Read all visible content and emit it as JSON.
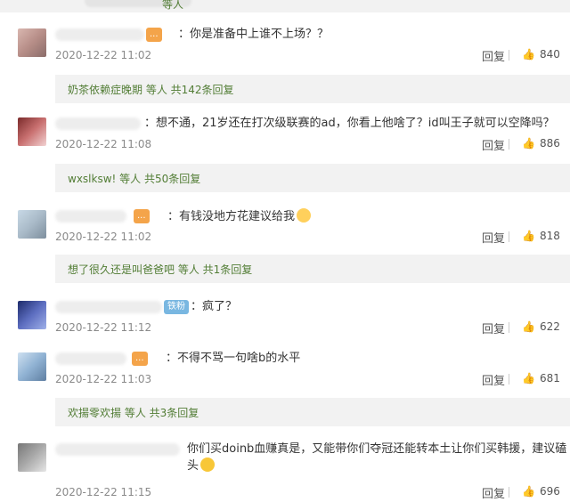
{
  "top": {
    "text": "等人"
  },
  "comments": [
    {
      "badge": "...",
      "text": "：你是准备中上谁不上场？？",
      "time": "2020-12-22 11:02",
      "reply_label": "回复",
      "likes": "840",
      "reply_summary": "奶茶依赖症晚期 等人 共142条回复"
    },
    {
      "badge": "",
      "text": "：想不通，21岁还在打次级联赛的ad，你看上他啥了？id叫王子就可以空降吗？",
      "time": "2020-12-22 11:08",
      "reply_label": "回复",
      "likes": "886",
      "reply_summary": "wxslksw! 等人 共50条回复"
    },
    {
      "badge": "...",
      "text": "：有钱没地方花建议给我",
      "time": "2020-12-22 11:02",
      "reply_label": "回复",
      "likes": "818",
      "reply_summary": "想了很久还是叫爸爸吧 等人 共1条回复"
    },
    {
      "badge": "铁粉",
      "text": "：疯了？",
      "time": "2020-12-22 11:12",
      "reply_label": "回复",
      "likes": "622",
      "reply_summary": ""
    },
    {
      "badge": "...",
      "text": "：不得不骂一句啥b的水平",
      "time": "2020-12-22 11:03",
      "reply_label": "回复",
      "likes": "681",
      "reply_summary": "欢揚零欢揚 等人 共3条回复"
    },
    {
      "badge": "",
      "text": "你们买doinb血赚真是，又能带你们夺冠还能转本土让你们买韩援，建议磕头",
      "time": "2020-12-22 11:15",
      "reply_label": "回复",
      "likes": "696",
      "reply_summary": ""
    }
  ]
}
